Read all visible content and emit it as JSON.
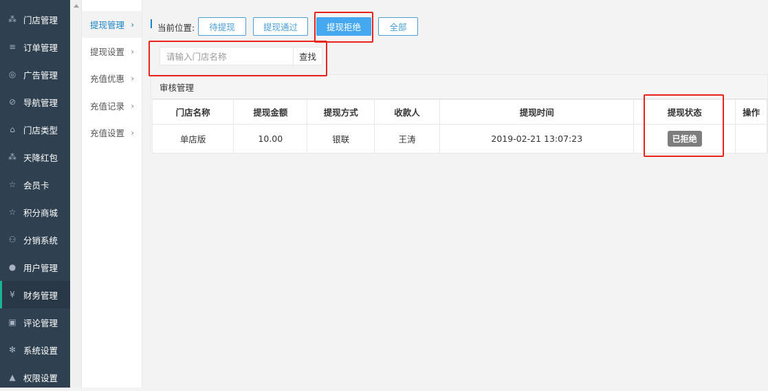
{
  "sidebar": {
    "items": [
      {
        "label": "门店管理",
        "icon": "cubes-icon",
        "glyph": "⁂"
      },
      {
        "label": "订单管理",
        "icon": "list-icon",
        "glyph": "≡"
      },
      {
        "label": "广告管理",
        "icon": "lifebuoy-icon",
        "glyph": "◎"
      },
      {
        "label": "导航管理",
        "icon": "compass-icon",
        "glyph": "⊘"
      },
      {
        "label": "门店类型",
        "icon": "bank-icon",
        "glyph": "⌂"
      },
      {
        "label": "天降红包",
        "icon": "cubes-icon",
        "glyph": "⁂"
      },
      {
        "label": "会员卡",
        "icon": "star-half-icon",
        "glyph": "☆"
      },
      {
        "label": "积分商城",
        "icon": "star-half-icon",
        "glyph": "☆"
      },
      {
        "label": "分销系统",
        "icon": "users-icon",
        "glyph": "⚇"
      },
      {
        "label": "用户管理",
        "icon": "user-icon",
        "glyph": "●"
      },
      {
        "label": "财务管理",
        "icon": "yen-icon",
        "glyph": "¥"
      },
      {
        "label": "评论管理",
        "icon": "money-icon",
        "glyph": "▣"
      },
      {
        "label": "系统设置",
        "icon": "gear-icon",
        "glyph": "✻"
      },
      {
        "label": "权限设置",
        "icon": "lock-icon",
        "glyph": "▲"
      }
    ]
  },
  "submenu": {
    "items": [
      {
        "label": "提现管理"
      },
      {
        "label": "提现设置"
      },
      {
        "label": "充值优惠"
      },
      {
        "label": "充值记录"
      },
      {
        "label": "充值设置"
      }
    ]
  },
  "breadcrumb": {
    "label": "当前位置:"
  },
  "filters": {
    "pending": "待提现",
    "approved": "提现通过",
    "rejected": "提现拒绝",
    "all": "全部"
  },
  "search": {
    "placeholder": "请输入门店名称",
    "button": "查找"
  },
  "panel": {
    "title": "审核管理"
  },
  "table": {
    "headers": [
      "门店名称",
      "提现金额",
      "提现方式",
      "收款人",
      "提现时间",
      "提现状态",
      "操作"
    ],
    "rows": [
      {
        "store": "单店版",
        "amount": "10.00",
        "method": "银联",
        "payee": "王涛",
        "time": "2019-02-21 13:07:23",
        "status": "已拒绝",
        "action": ""
      }
    ]
  },
  "colors": {
    "sidebar_bg": "#2f4050",
    "accent_blue": "#46a9f0",
    "highlight_red": "#e8231c",
    "badge_gray": "#7d7d7d"
  }
}
